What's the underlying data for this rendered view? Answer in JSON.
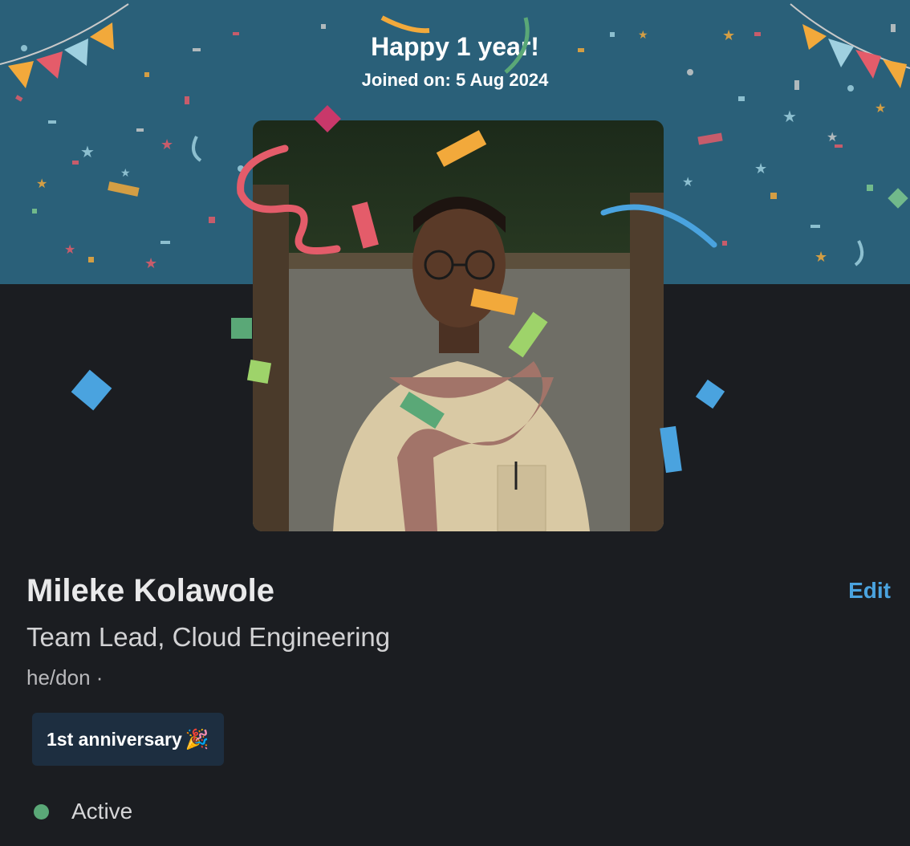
{
  "banner": {
    "headline": "Happy 1 year!",
    "joined_text": "Joined on: 5 Aug 2024",
    "background_color": "#2a6079"
  },
  "profile": {
    "name": "Mileke Kolawole",
    "title": "Team Lead, Cloud Engineering",
    "pronouns": "he/don ·",
    "edit_label": "Edit"
  },
  "badge": {
    "label": "1st anniversary",
    "emoji": "🎉",
    "icon": "party-popper-icon"
  },
  "status": {
    "label": "Active",
    "color": "#5aa877"
  },
  "colors": {
    "accent": "#4aa3df",
    "page_background": "#1b1d21",
    "badge_background": "#1d2e40"
  }
}
